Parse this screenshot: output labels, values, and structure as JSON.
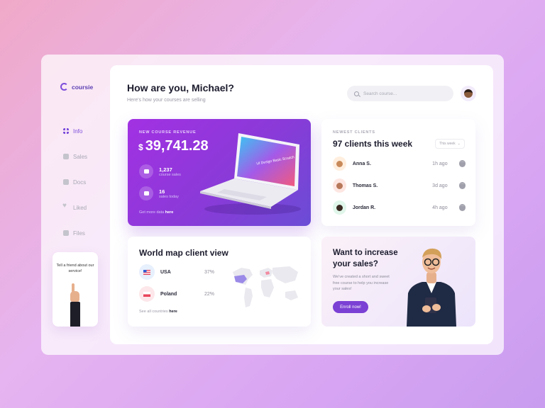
{
  "brand": {
    "name": "coursie",
    "accent": "#7c4ddb"
  },
  "nav": [
    {
      "label": "Info",
      "icon": "grid-icon",
      "active": true
    },
    {
      "label": "Sales",
      "icon": "sales-icon",
      "active": false
    },
    {
      "label": "Docs",
      "icon": "docs-icon",
      "active": false
    },
    {
      "label": "Liked",
      "icon": "heart-icon",
      "active": false
    },
    {
      "label": "Files",
      "icon": "files-icon",
      "active": false
    }
  ],
  "invite": {
    "text": "Tell a friend about our service!"
  },
  "header": {
    "greeting": "How are you, Michael?",
    "subtitle": "Here's how your courses are selling",
    "search_placeholder": "Search course..."
  },
  "revenue": {
    "label": "NEW COURSE REVENUE",
    "currency": "$",
    "amount": "39,741.28",
    "stats": [
      {
        "value": "1,237",
        "label": "course sales"
      },
      {
        "value": "16",
        "label": "sales today"
      }
    ],
    "footer_prefix": "Get more data",
    "footer_link": "here",
    "screen_title": "UI Design Basic Scratch",
    "gradient": [
      "#a231e3",
      "#6b4dd6"
    ]
  },
  "clients": {
    "label": "NEWEST CLIENTS",
    "title": "97 clients this week",
    "filter": "This week",
    "items": [
      {
        "name": "Anna S.",
        "time": "1h ago",
        "avatar_bg": "#ffeede"
      },
      {
        "name": "Thomas S.",
        "time": "3d ago",
        "avatar_bg": "#fde6e2"
      },
      {
        "name": "Jordan R.",
        "time": "4h ago",
        "avatar_bg": "#e0f6ea"
      }
    ]
  },
  "worldmap": {
    "title": "World map client view",
    "countries": [
      {
        "name": "USA",
        "pct": "37%"
      },
      {
        "name": "Poland",
        "pct": "22%"
      }
    ],
    "footer_prefix": "See all countries",
    "footer_link": "here"
  },
  "promo": {
    "title": "Want to increase your sales?",
    "text": "We've created a short and sweet free course to help you increase your sales!",
    "button": "Enroll now!"
  }
}
